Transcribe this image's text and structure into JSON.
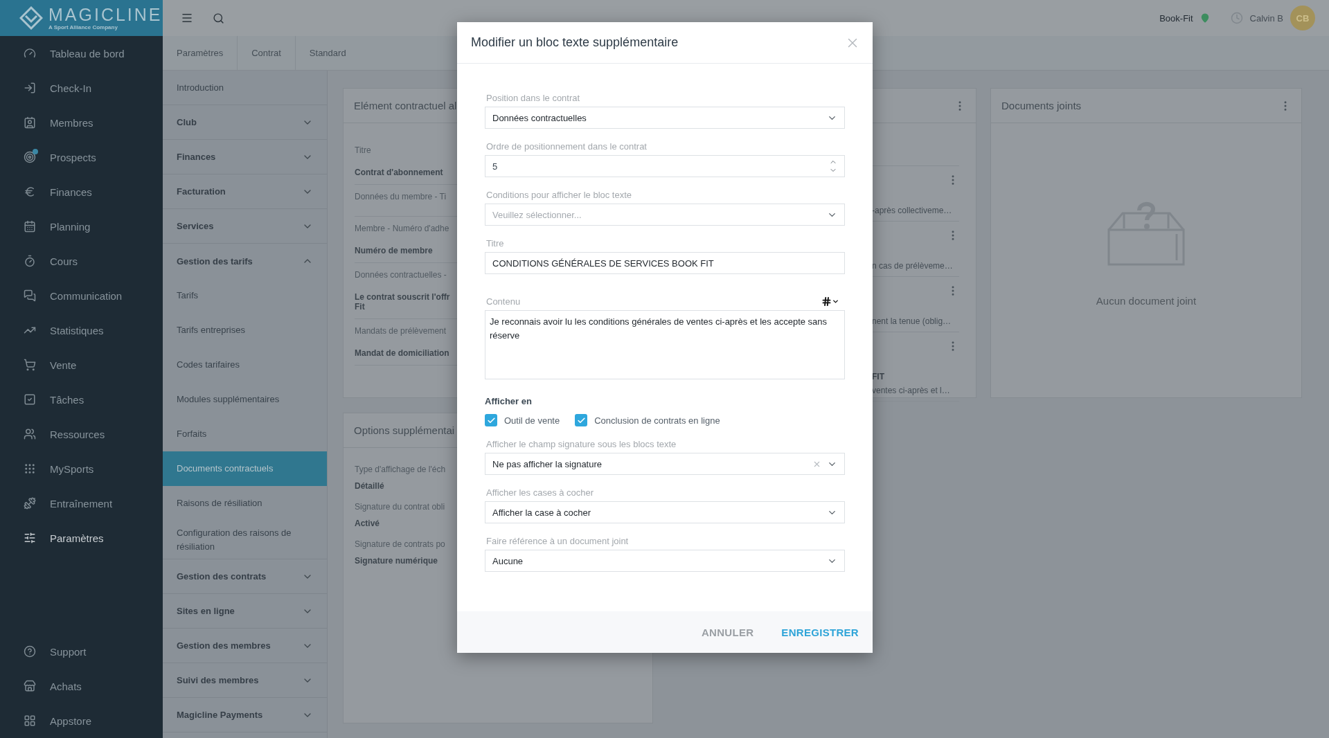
{
  "brand": {
    "name": "MAGICLINE",
    "tagline": "A Sport Alliance Company"
  },
  "sidebar": {
    "items": [
      {
        "label": "Tableau de bord",
        "selected": false,
        "notification_dot": false
      },
      {
        "label": "Check-In",
        "selected": false,
        "notification_dot": false
      },
      {
        "label": "Membres",
        "selected": false,
        "notification_dot": false
      },
      {
        "label": "Prospects",
        "selected": false,
        "notification_dot": true
      },
      {
        "label": "Finances",
        "selected": false,
        "notification_dot": false
      },
      {
        "label": "Planning",
        "selected": false,
        "notification_dot": false
      },
      {
        "label": "Cours",
        "selected": false,
        "notification_dot": false
      },
      {
        "label": "Communication",
        "selected": false,
        "notification_dot": false
      },
      {
        "label": "Statistiques",
        "selected": false,
        "notification_dot": false
      },
      {
        "label": "Vente",
        "selected": false,
        "notification_dot": false
      },
      {
        "label": "Tâches",
        "selected": false,
        "notification_dot": false
      },
      {
        "label": "Ressources",
        "selected": false,
        "notification_dot": false
      },
      {
        "label": "MySports",
        "selected": false,
        "notification_dot": false
      },
      {
        "label": "Entraînement",
        "selected": false,
        "notification_dot": false
      },
      {
        "label": "Paramètres",
        "selected": true,
        "notification_dot": false
      }
    ],
    "bottom_items": [
      {
        "label": "Support",
        "selected": false
      },
      {
        "label": "Achats",
        "selected": false
      },
      {
        "label": "Appstore",
        "selected": false
      }
    ]
  },
  "topbar": {
    "location": "Book-Fit",
    "user": "Calvin B",
    "avatar_initials": "CB"
  },
  "breadcrumb": [
    "Paramètres",
    "Contrat",
    "Standard"
  ],
  "settings_menu": [
    {
      "kind": "link",
      "label": "Introduction",
      "selected": false
    },
    {
      "kind": "group",
      "label": "Club",
      "expanded": false
    },
    {
      "kind": "group",
      "label": "Finances",
      "expanded": false
    },
    {
      "kind": "group",
      "label": "Facturation",
      "expanded": false
    },
    {
      "kind": "group",
      "label": "Services",
      "expanded": false
    },
    {
      "kind": "group",
      "label": "Gestion des tarifs",
      "expanded": true,
      "children": [
        {
          "kind": "link",
          "label": "Tarifs",
          "selected": false
        },
        {
          "kind": "link",
          "label": "Tarifs entreprises",
          "selected": false
        },
        {
          "kind": "link",
          "label": "Codes tarifaires",
          "selected": false
        },
        {
          "kind": "link",
          "label": "Modules supplémentaires",
          "selected": false
        },
        {
          "kind": "link",
          "label": "Forfaits",
          "selected": false
        },
        {
          "kind": "link",
          "label": "Documents contractuels",
          "selected": true
        },
        {
          "kind": "link",
          "label": "Raisons de résiliation",
          "selected": false
        },
        {
          "kind": "link",
          "label": "Configuration des raisons de résiliation",
          "selected": false
        }
      ]
    },
    {
      "kind": "group",
      "label": "Gestion des contrats",
      "expanded": false
    },
    {
      "kind": "group",
      "label": "Sites en ligne",
      "expanded": false
    },
    {
      "kind": "group",
      "label": "Gestion des membres",
      "expanded": false
    },
    {
      "kind": "group",
      "label": "Suivi des membres",
      "expanded": false
    },
    {
      "kind": "group",
      "label": "Magicline Payments",
      "expanded": false
    }
  ],
  "contract_card": {
    "title": "Elément contractuel al",
    "left_items": [
      {
        "label": "Titre",
        "value_lines": [
          "Contrat d'abonnement"
        ]
      },
      {
        "label": "Données du membre - Ti"
      },
      {
        "label": "Membre - Numéro d'adhe",
        "value_lines": [
          "Numéro de membre"
        ]
      },
      {
        "label": "Données contractuelles -",
        "value_lines": [
          "Le contrat souscrit l'offr",
          "Fit"
        ]
      },
      {
        "label": "Mandats de prélèvement",
        "value_lines": [
          "Mandat de domiciliation"
        ]
      }
    ],
    "right_items": [
      {
        "text": "-après collectiveme…"
      },
      {
        "text": "n cas de prélèveme…"
      },
      {
        "text": "nent la tenue (oblig…"
      },
      {
        "heading": "FIT",
        "text": "ventes ci-après et l…"
      }
    ]
  },
  "attachments_card": {
    "title": "Documents joints",
    "empty_text": "Aucun document joint"
  },
  "options_card": {
    "title": "Options supplémentai",
    "items": [
      {
        "label": "Type d'affichage de l'éch",
        "value": "Détaillé"
      },
      {
        "label": "Signature du contrat obli",
        "value": "Activé"
      },
      {
        "label": "Signature de contrats po",
        "value": "Signature numérique"
      }
    ]
  },
  "dialog": {
    "title": "Modifier un bloc texte supplémentaire",
    "fields": [
      {
        "kind": "select",
        "label": "Position dans le contrat",
        "value": "Données contractuelles",
        "clearable": false
      },
      {
        "kind": "number",
        "label": "Ordre de positionnement dans le contrat",
        "value": "5"
      },
      {
        "kind": "select",
        "label": "Conditions pour afficher le bloc texte",
        "placeholder": "Veuillez sélectionner...",
        "clearable": false
      },
      {
        "kind": "text",
        "label": "Titre",
        "value": "CONDITIONS GÉNÉRALES DE SERVICES BOOK FIT"
      },
      {
        "kind": "textarea",
        "label": "Contenu",
        "value": "Je reconnais avoir lu les conditions générales de ventes ci-après et les accepte sans réserve"
      },
      {
        "kind": "checkbox_group",
        "label": "Afficher en",
        "options": [
          {
            "label": "Outil de vente",
            "checked": true
          },
          {
            "label": "Conclusion de contrats en ligne",
            "checked": true
          }
        ]
      },
      {
        "kind": "select",
        "label": "Afficher le champ signature sous les blocs texte",
        "value": "Ne pas afficher la signature",
        "clearable": true
      },
      {
        "kind": "select",
        "label": "Afficher les cases à cocher",
        "value": "Afficher la case à cocher",
        "clearable": false
      },
      {
        "kind": "select",
        "label": "Faire référence à un document joint",
        "value": "Aucune",
        "clearable": false
      }
    ],
    "buttons": [
      {
        "kind": "secondary",
        "label": "ANNULER"
      },
      {
        "kind": "primary",
        "label": "ENREGISTRER"
      }
    ]
  }
}
